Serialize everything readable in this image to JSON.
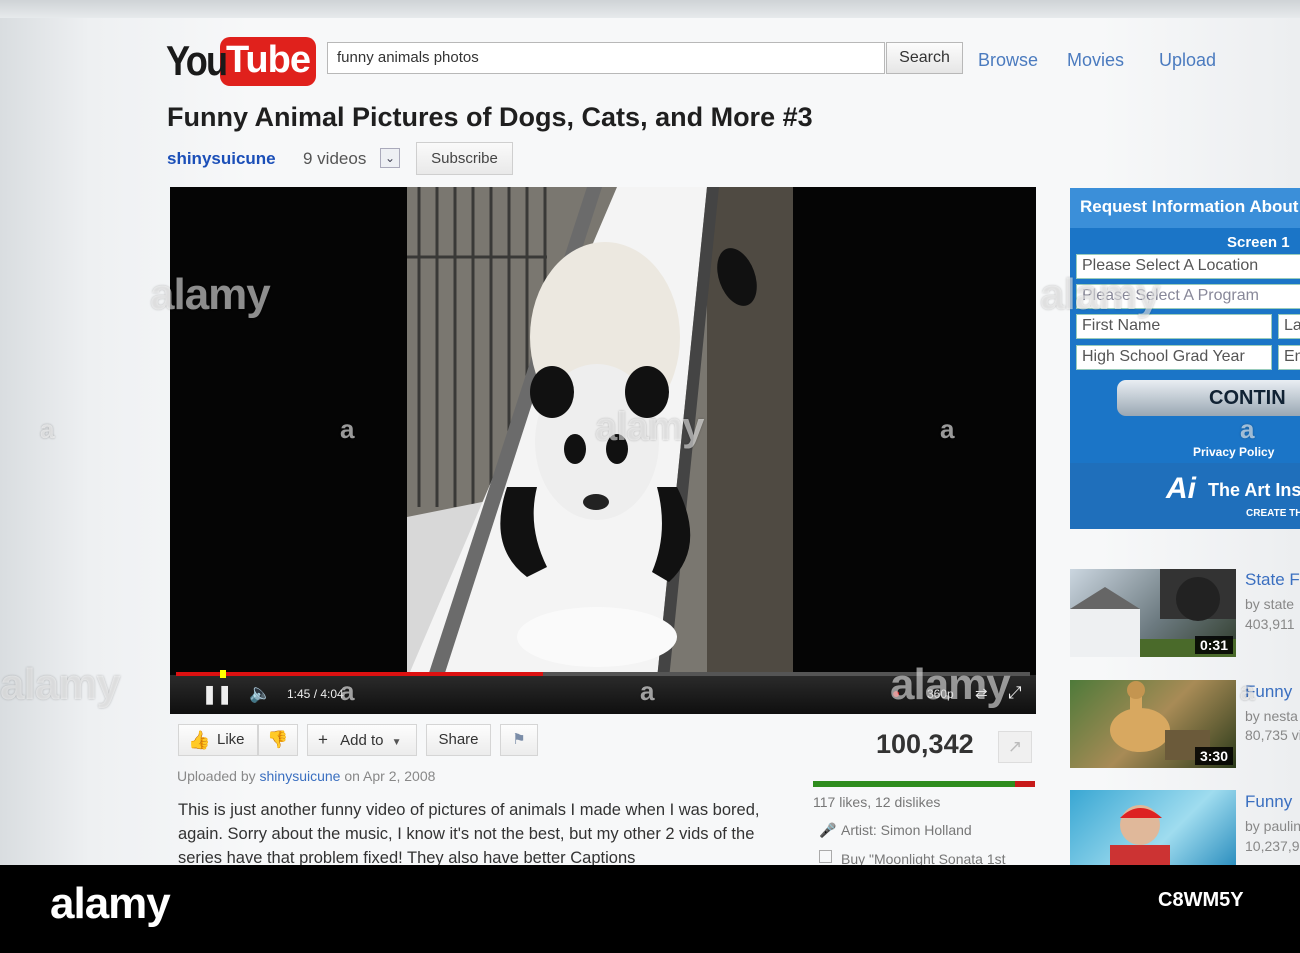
{
  "header": {
    "logo_you": "You",
    "logo_tube": "Tube",
    "search_value": "funny animals photos",
    "search_button": "Search",
    "nav": [
      "Browse",
      "Movies",
      "Upload"
    ]
  },
  "video": {
    "title": "Funny Animal Pictures of Dogs, Cats, and More #3",
    "channel": "shinysuicune",
    "video_count": "9 videos",
    "subscribe_label": "Subscribe",
    "time": "1:45 / 4:04",
    "quality": "360p",
    "progress": 0.43,
    "views": "100,342",
    "likes_dislikes": "117 likes, 12 dislikes",
    "like_ratio": 0.91,
    "artist": "Artist: Simon Holland",
    "buy": "Buy \"Moonlight Sonata 1st"
  },
  "actions": {
    "like": "Like",
    "add_to": "Add to",
    "share": "Share"
  },
  "uploader": {
    "prefix": "Uploaded by",
    "user": "shinysuicune",
    "date": "on Apr 2, 2008"
  },
  "description": "This is just another funny video of pictures of animals I made when I was bored, again. Sorry about the music, I know it's not the best, but my other 2 vids of the series have that problem fixed! They also have better Captions",
  "ad": {
    "heading": "Request Information About",
    "screen": "Screen 1",
    "location": "Please Select A Location",
    "program": "Please Select A Program",
    "first_name": "First Name",
    "last_name": "La",
    "grad_year": "High School Grad Year",
    "email": "Em",
    "continue": "CONTIN",
    "privacy": "Privacy Policy",
    "brand_mark": "Ai",
    "brand": "The Art Ins",
    "tagline": "CREATE TH"
  },
  "related": [
    {
      "title": "State F",
      "by": "by state",
      "views": "403,911",
      "duration": "0:31"
    },
    {
      "title": "Funny",
      "by": "by nesta",
      "views": "80,735 vi",
      "duration": "3:30"
    },
    {
      "title": "Funny",
      "by": "by paulin",
      "views": "10,237,9",
      "duration": ""
    }
  ],
  "watermark": {
    "brand": "alamy",
    "image_id": "C8WM5Y",
    "glyph": "a"
  },
  "colors": {
    "youtube_red": "#e0211c",
    "link_blue": "#1b4fb8",
    "ad_blue": "#1b75c7",
    "like_green": "#2f8d1e",
    "dislike_red": "#c71a1a"
  }
}
